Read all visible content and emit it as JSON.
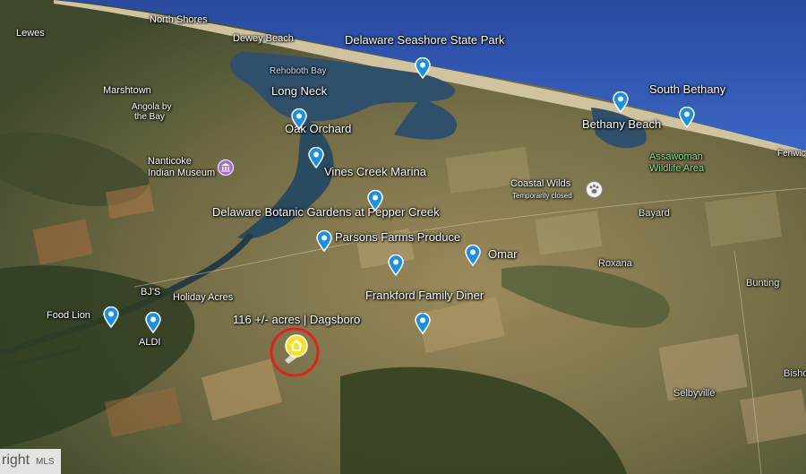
{
  "places": {
    "north_shores": "North Shores",
    "lewes": "Lewes",
    "dewey_beach": "Dewey Beach",
    "rehoboth_bay": "Rehoboth Bay",
    "marshtown": "Marshtown",
    "long_neck": "Long Neck",
    "angola_line1": "Angola by",
    "angola_line2": "the Bay",
    "oak_orchard": "Oak Orchard",
    "nanticoke_line1": "Nanticoke",
    "nanticoke_line2": "Indian Museum",
    "vines_creek": "Vines Creek Marina",
    "delaware_seashore": "Delaware Seashore State Park",
    "south_bethany": "South Bethany",
    "bethany_beach": "Bethany Beach",
    "assawoman_line1": "Assawoman",
    "assawoman_line2": "Wildlife Area",
    "fenwick": "Fenwic",
    "coastal_wilds": "Coastal Wilds",
    "coastal_wilds_status": "Temporarily closed",
    "botanic_gardens": "Delaware Botanic Gardens at Pepper Creek",
    "bayard": "Bayard",
    "parsons_farms": "Parsons Farms Produce",
    "omar": "Omar",
    "roxana": "Roxana",
    "bjs": "BJ'S",
    "holiday_acres": "Holiday Acres",
    "frankford_diner": "Frankford Family Diner",
    "bunting": "Bunting",
    "food_lion": "Food Lion",
    "aldi": "ALDI",
    "property_label": "116 +/- acres | Dagsboro",
    "bisho": "Bisho",
    "selbyville": "Selbyville"
  },
  "watermark": {
    "text_main": "right",
    "text_badge": "MLS"
  },
  "colors": {
    "ocean": "#2f56b5",
    "pin_blue": "#1b8fe0",
    "property_marker": "#f5e12a",
    "ring_red": "#e0221c"
  },
  "icons": {
    "pin": "map-pin-icon",
    "museum": "museum-icon",
    "pet": "paw-icon",
    "property": "home-icon"
  }
}
